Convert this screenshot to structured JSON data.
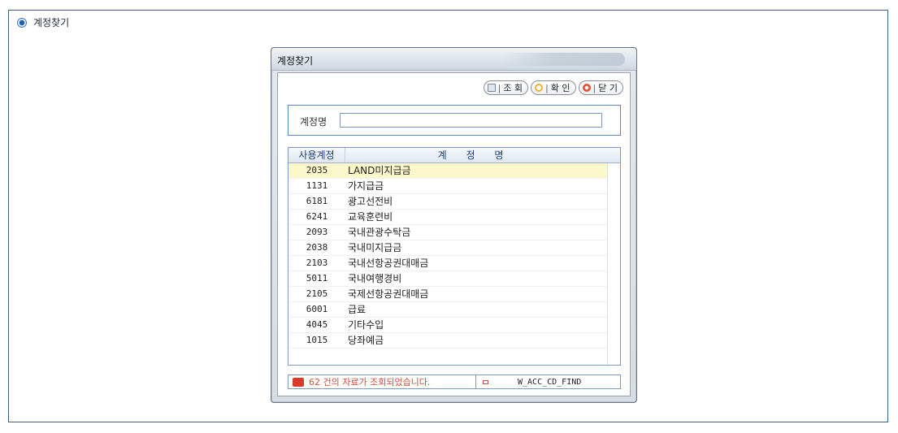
{
  "page": {
    "title": "계정찾기"
  },
  "popup": {
    "title": "계정찾기",
    "toolbar": {
      "search_label": "조 회",
      "confirm_label": "확 인",
      "close_label": "닫 기",
      "separator": "|"
    },
    "search": {
      "label": "계정명",
      "value": ""
    },
    "grid": {
      "headers": {
        "code": "사용계정",
        "name": "계  정  명"
      },
      "rows": [
        {
          "code": "2035",
          "name": "LAND미지급금",
          "selected": true
        },
        {
          "code": "1131",
          "name": "가지급금"
        },
        {
          "code": "6181",
          "name": "광고선전비"
        },
        {
          "code": "6241",
          "name": "교육훈련비"
        },
        {
          "code": "2093",
          "name": "국내관광수탁금"
        },
        {
          "code": "2038",
          "name": "국내미지급금"
        },
        {
          "code": "2103",
          "name": "국내선항공권대매금"
        },
        {
          "code": "5011",
          "name": "국내여행경비"
        },
        {
          "code": "2105",
          "name": "국제선항공권대매금"
        },
        {
          "code": "6001",
          "name": "급료"
        },
        {
          "code": "4045",
          "name": "기타수입"
        },
        {
          "code": "1015",
          "name": "당좌예금"
        }
      ]
    },
    "status": {
      "message": "62 건의 자료가 조회되었습니다.",
      "form_id": "W_ACC_CD_FIND"
    }
  },
  "icons": {
    "header": "radio-selected-icon",
    "search_button": "search-icon",
    "confirm_button": "confirm-icon",
    "close_button": "close-icon",
    "status": "message-icon"
  },
  "colors": {
    "frame_border": "#3e5f7c",
    "selected_row": "#fdf8cc",
    "status_text": "#d84a3a",
    "grid_header_text": "#1d3f7a"
  }
}
